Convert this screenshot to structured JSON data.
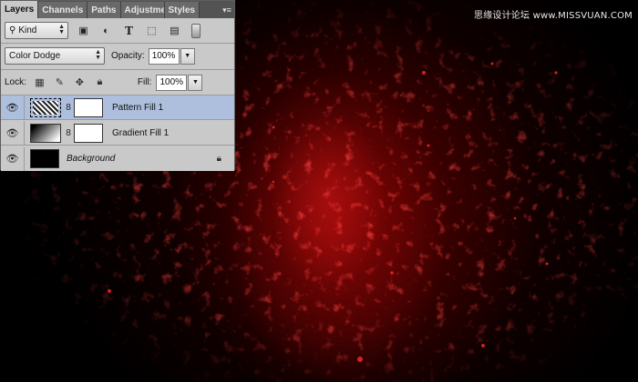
{
  "panel": {
    "tabs": [
      {
        "label": "Layers",
        "active": true
      },
      {
        "label": "Channels",
        "active": false
      },
      {
        "label": "Paths",
        "active": false
      },
      {
        "label": "Adjustme",
        "active": false
      },
      {
        "label": "Styles",
        "active": false
      }
    ],
    "filter": {
      "value": "Kind"
    },
    "blend_mode": {
      "value": "Color Dodge"
    },
    "opacity": {
      "label": "Opacity:",
      "value": "100%"
    },
    "lock": {
      "label": "Lock:"
    },
    "fill": {
      "label": "Fill:",
      "value": "100%"
    },
    "layers": [
      {
        "name": "Pattern Fill 1",
        "thumb": "pattern",
        "selected": true,
        "mask": true
      },
      {
        "name": "Gradient Fill 1",
        "thumb": "gradient",
        "selected": false,
        "mask": true
      },
      {
        "name": "Background",
        "thumb": "black",
        "selected": false,
        "mask": false,
        "locked": true
      }
    ]
  },
  "watermark": "思缘设计论坛 www.MISSVUAN.COM",
  "colors": {
    "panel_bg": "#c9c9c9",
    "selected_layer": "#aebfdd",
    "tabbar": "#535353",
    "canvas_red": "#c81414"
  },
  "icons": [
    "eye-icon",
    "link-chain-icon",
    "padlock-icon",
    "search-icon",
    "move-icon",
    "brush-icon"
  ]
}
